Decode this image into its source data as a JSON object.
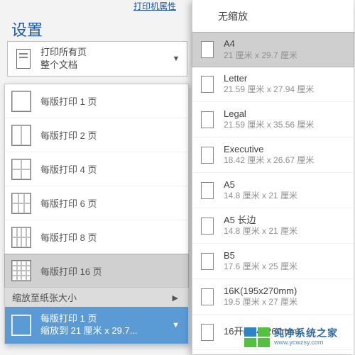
{
  "top_link": "打印机属性",
  "section_title": "设置",
  "print_what": {
    "line1": "打印所有页",
    "line2": "整个文档"
  },
  "pages_per_sheet": {
    "items": [
      {
        "label": "每版打印 1 页",
        "grid": "g1",
        "cells": 1
      },
      {
        "label": "每版打印 2 页",
        "grid": "g2",
        "cells": 2
      },
      {
        "label": "每版打印 4 页",
        "grid": "g4",
        "cells": 4
      },
      {
        "label": "每版打印 6 页",
        "grid": "g6",
        "cells": 6
      },
      {
        "label": "每版打印 8 页",
        "grid": "g8",
        "cells": 8
      },
      {
        "label": "每版打印 16 页",
        "grid": "g16",
        "cells": 16
      }
    ],
    "selected_index": 5,
    "scale_header": "缩放至纸张大小",
    "current": {
      "line1": "每版打印 1 页",
      "line2": "缩放到 21 厘米 x 29.7..."
    }
  },
  "paper_size": {
    "header": "无缩放",
    "selected_index": 0,
    "items": [
      {
        "name": "A4",
        "dim": "21 厘米 x 29.7 厘米"
      },
      {
        "name": "Letter",
        "dim": "21.59 厘米 x 27.94 厘米"
      },
      {
        "name": "Legal",
        "dim": "21.59 厘米 x 35.56 厘米"
      },
      {
        "name": "Executive",
        "dim": "18.42 厘米 x 26.67 厘米"
      },
      {
        "name": "A5",
        "dim": "14.8 厘米 x 21 厘米"
      },
      {
        "name": "A5 长边",
        "dim": "14.8 厘米 x 21 厘米"
      },
      {
        "name": "B5",
        "dim": "17.6 厘米 x 25 厘米"
      },
      {
        "name": "16K(195x270mm)",
        "dim": "19.5 厘米 x 27 厘米"
      },
      {
        "name": "16开(184x260mm)",
        "dim": ""
      }
    ]
  },
  "watermark": {
    "cn": "纯净系统之家",
    "en": "www.ycwzsy.com"
  }
}
